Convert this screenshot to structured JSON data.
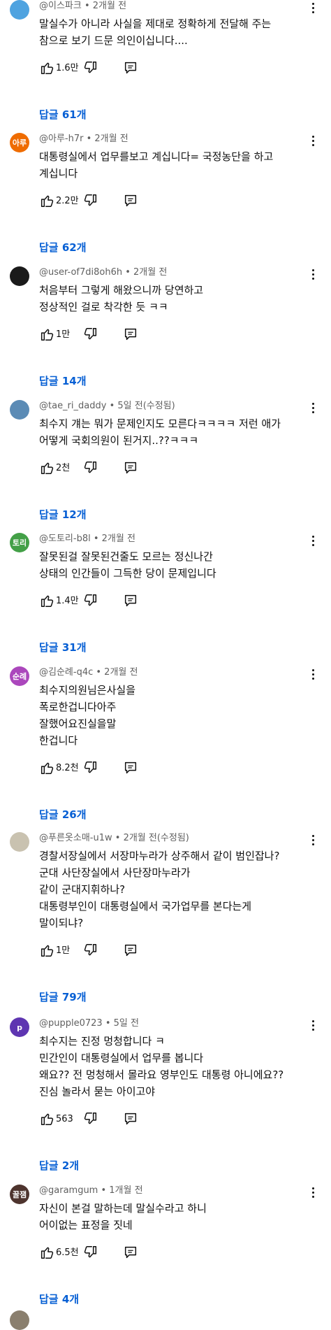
{
  "comments": [
    {
      "avatar": "",
      "avatar_color": "#4fa3e0",
      "meta": "@이스파크 • 2개월 전",
      "text": "말실수가 아니라 사실을 제대로 정확하게 전달해 주는\n참으로 보기 드문 의인이십니다....",
      "likes": "1.6만",
      "replies": "답글 61개"
    },
    {
      "avatar": "아루",
      "avatar_color": "#ef6c00",
      "meta": "@아루-h7r • 2개월 전",
      "text": "대통령실에서 업무를보고 계십니다= 국정농단을 하고\n계십니다",
      "likes": "2.2만",
      "replies": "답글 62개"
    },
    {
      "avatar": "",
      "avatar_color": "#1a1a1a",
      "meta": "@user-of7di8oh6h • 2개월 전",
      "text": "처음부터 그렇게 해왔으니까 당연하고\n정상적인 걸로 착각한 듯 ㅋㅋ",
      "likes": "1만",
      "replies": "답글 14개"
    },
    {
      "avatar": "",
      "avatar_color": "#5b8bb5",
      "meta": "@tae_ri_daddy • 5일 전(수정됨)",
      "text": "최수지 걔는 뭐가 문제인지도 모른다ㅋㅋㅋㅋ 저런 애가\n어떻게 국회의원이 된거지..??ㅋㅋㅋ",
      "likes": "2천",
      "replies": "답글 12개"
    },
    {
      "avatar": "토리",
      "avatar_color": "#43a047",
      "meta": "@도토리-b8l • 2개월 전",
      "text": "잘못된걸 잘못된건줄도 모르는 정신나간\n상태의 인간들이 그득한 당이 문제입니다",
      "likes": "1.4만",
      "replies": "답글 31개"
    },
    {
      "avatar": "순례",
      "avatar_color": "#ab47bc",
      "meta": "@김순례-q4c • 2개월 전",
      "text": "최수지의원님은사실을\n폭로한겁니다아주\n잘했어요진실을말\n한겁니다",
      "likes": "8.2천",
      "replies": "답글 26개"
    },
    {
      "avatar": "",
      "avatar_color": "#c9c2b0",
      "meta": "@푸른옷소매-u1w • 2개월 전(수정됨)",
      "text": "경찰서장실에서 서장마누라가 상주해서 같이  범인잡나?\n군대 사단장실에서 사단장마누라가\n같이 군대지휘하나?\n대통령부인이 대통령실에서 국가업무를 본다는게\n말이되냐?",
      "likes": "1만",
      "replies": "답글 79개"
    },
    {
      "avatar": "p",
      "avatar_color": "#5e35b1",
      "meta": "@pupple0723 • 5일 전",
      "text": "최수지는 진정 멍청합니다 ㅋ\n민간인이 대통령실에서 업무를 봅니다\n왜요?? 전 멍청해서 몰라요 영부인도 대통령 아니에요??\n진심 놀라서 묻는 아이고야",
      "likes": "563",
      "replies": "답글 2개"
    },
    {
      "avatar": "꿀잼",
      "avatar_color": "#4e342e",
      "meta": "@garamgum • 1개월 전",
      "text": "자신이 본걸 말하는데 말실수라고 하니\n어이없는 표정을 짓네",
      "likes": "6.5천",
      "replies": "답글 4개"
    }
  ]
}
